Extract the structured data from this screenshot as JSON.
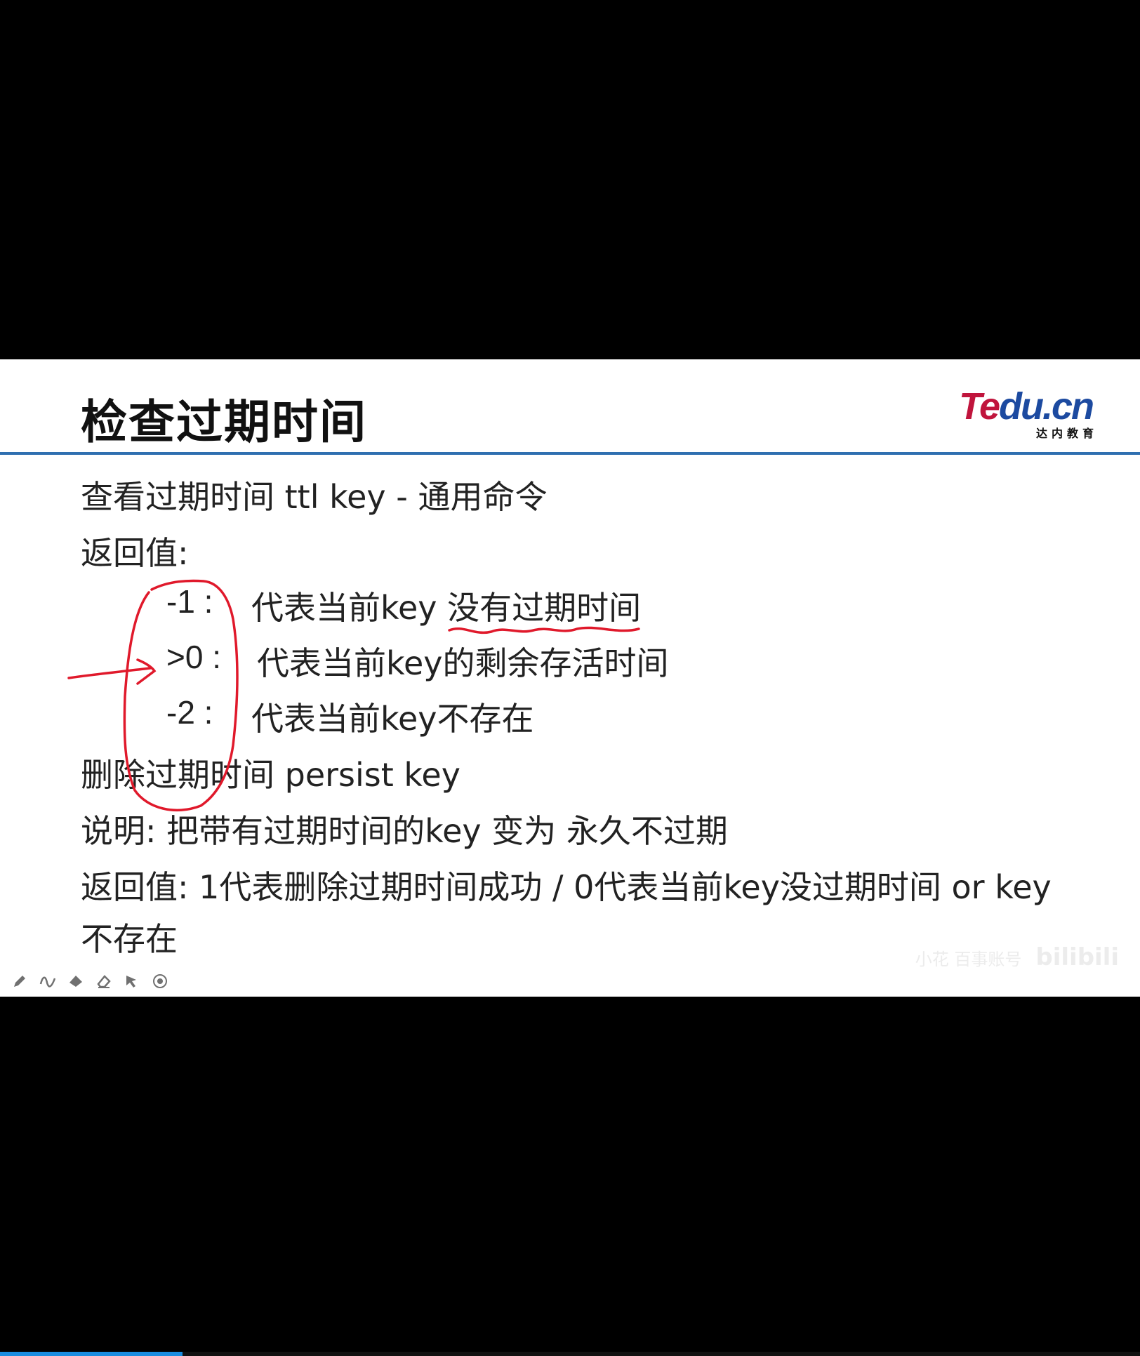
{
  "slide": {
    "title": "检查过期时间",
    "logo": {
      "brand_te": "Te",
      "brand_rest": "du.cn",
      "subtitle": "达内教育"
    },
    "lines": {
      "view_ttl": "查看过期时间 ttl key - 通用命令",
      "return_label": "返回值:",
      "rv_neg1_code": "-1 :",
      "rv_neg1_desc": "代表当前key 没有过期时间",
      "rv_pos_code": ">0 :",
      "rv_pos_desc": "代表当前key的剩余存活时间",
      "rv_neg2_code": "-2 :",
      "rv_neg2_desc": "代表当前key不存在",
      "persist": "删除过期时间 persist key",
      "explain": "说明:  把带有过期时间的key 变为 永久不过期",
      "return_persist_1": "返回值:  1代表删除过期时间成功 / 0代表当前key没过期时间 or key",
      "return_persist_2": "不存在"
    },
    "annotation_color": "#e0192b"
  },
  "toolbar": {
    "tools": [
      {
        "icon": "pen-icon"
      },
      {
        "icon": "squiggle-icon"
      },
      {
        "icon": "highlighter-icon"
      },
      {
        "icon": "eraser-icon"
      },
      {
        "icon": "pointer-icon"
      },
      {
        "icon": "target-icon"
      }
    ]
  },
  "watermark": {
    "small_text": "小花 百事账号",
    "brand": "bilibili"
  },
  "playback": {
    "progress_fraction": 0.16
  }
}
